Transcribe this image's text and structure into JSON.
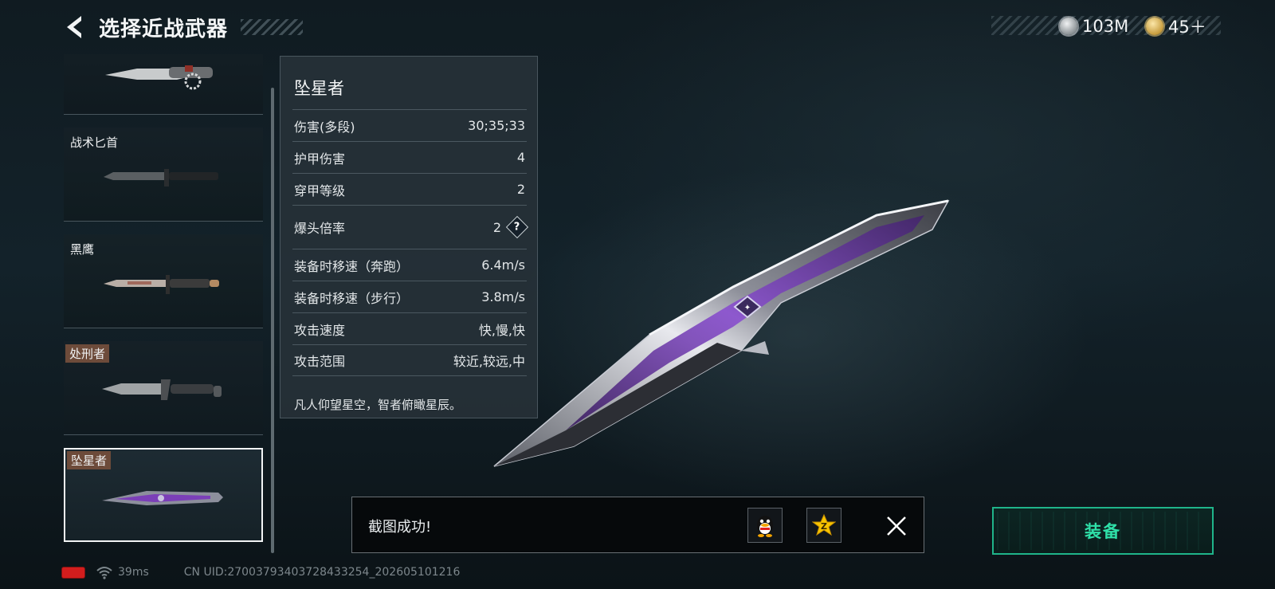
{
  "header": {
    "title": "选择近战武器",
    "back_icon": "back-arrow-icon",
    "currencies": [
      {
        "icon": "silver-coin-icon",
        "value": "103M"
      },
      {
        "icon": "gold-coin-icon",
        "value": "45＋"
      }
    ]
  },
  "weapon_list": {
    "items": [
      {
        "label": "",
        "tag": false,
        "selected": false
      },
      {
        "label": "战术匕首",
        "tag": false,
        "selected": false
      },
      {
        "label": "黑鹰",
        "tag": false,
        "selected": false
      },
      {
        "label": "处刑者",
        "tag": true,
        "selected": false
      },
      {
        "label": "坠星者",
        "tag": true,
        "selected": true
      }
    ]
  },
  "detail": {
    "name": "坠星者",
    "stats": [
      {
        "label": "伤害(多段)",
        "value": "30;35;33"
      },
      {
        "label": "护甲伤害",
        "value": "4"
      },
      {
        "label": "穿甲等级",
        "value": "2"
      },
      {
        "label": "爆头倍率",
        "value": "2",
        "help": "?"
      },
      {
        "label": "装备时移速（奔跑）",
        "value": "6.4m/s"
      },
      {
        "label": "装备时移速（步行）",
        "value": "3.8m/s"
      },
      {
        "label": "攻击速度",
        "value": "快,慢,快"
      },
      {
        "label": "攻击范围",
        "value": "较近,较远,中"
      }
    ],
    "description": "凡人仰望星空，智者俯瞰星辰。"
  },
  "toast": {
    "message": "截图成功!",
    "share_targets": [
      "qq-icon",
      "qzone-icon"
    ],
    "close_icon": "close-icon"
  },
  "equip_button": {
    "label": "装备"
  },
  "statusbar": {
    "battery_color": "#d21d1d",
    "ping": "39ms",
    "uid": "CN UID:27003793403728433254_202605101216"
  },
  "colors": {
    "accent": "#2fe0a8",
    "tag_bg": "#6d4b3a",
    "panel_bg": "#28323a"
  }
}
